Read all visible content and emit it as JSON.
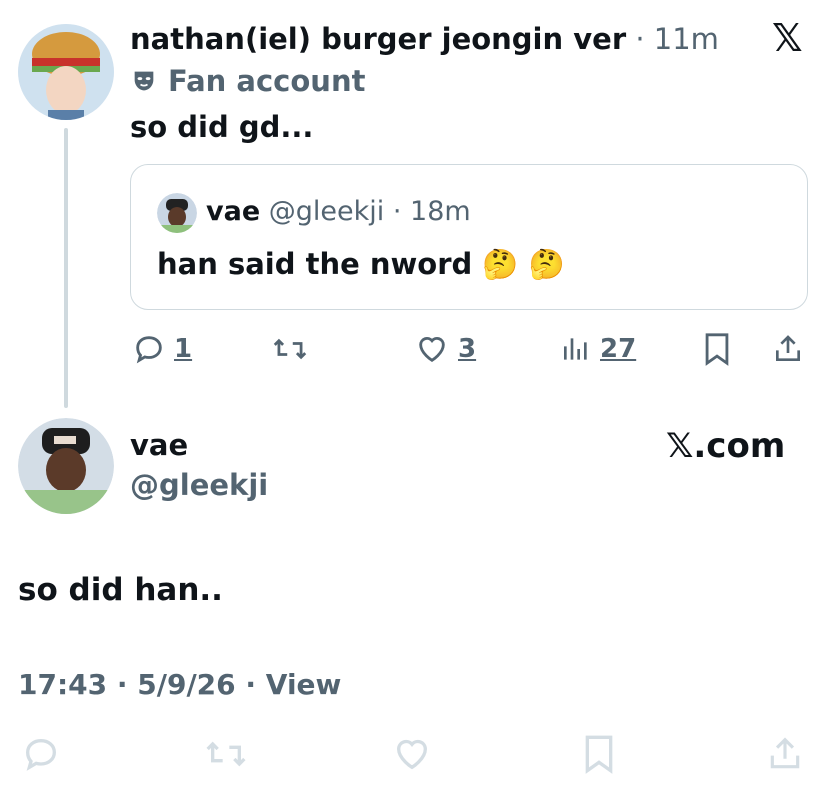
{
  "reply": {
    "display_name": "nathan(iel) burger jeongin ver",
    "separator": "·",
    "time": "11m",
    "badge": "Fan account",
    "text": "so did gd...",
    "close_glyph": "𝕏",
    "quote": {
      "name": "vae",
      "handle": "@gleekji",
      "separator": "·",
      "time": "18m",
      "text": "han said the nword",
      "emoji": "🤔 🤔"
    },
    "actions": {
      "replies": "1",
      "likes": "3",
      "views": "27"
    }
  },
  "main": {
    "name": "vae",
    "handle": "@gleekji",
    "brand": "𝕏.com",
    "text": "so did han..",
    "meta": "17:43 · 5/9/26 · View"
  },
  "colors": {
    "text": "#0f1419",
    "muted": "#536471",
    "faded": "#d4dde3",
    "border": "#cfd9de"
  },
  "icons": [
    "close-x-icon",
    "mask-icon",
    "reply-icon",
    "retweet-icon",
    "like-icon",
    "views-icon",
    "bookmark-icon",
    "share-icon"
  ]
}
